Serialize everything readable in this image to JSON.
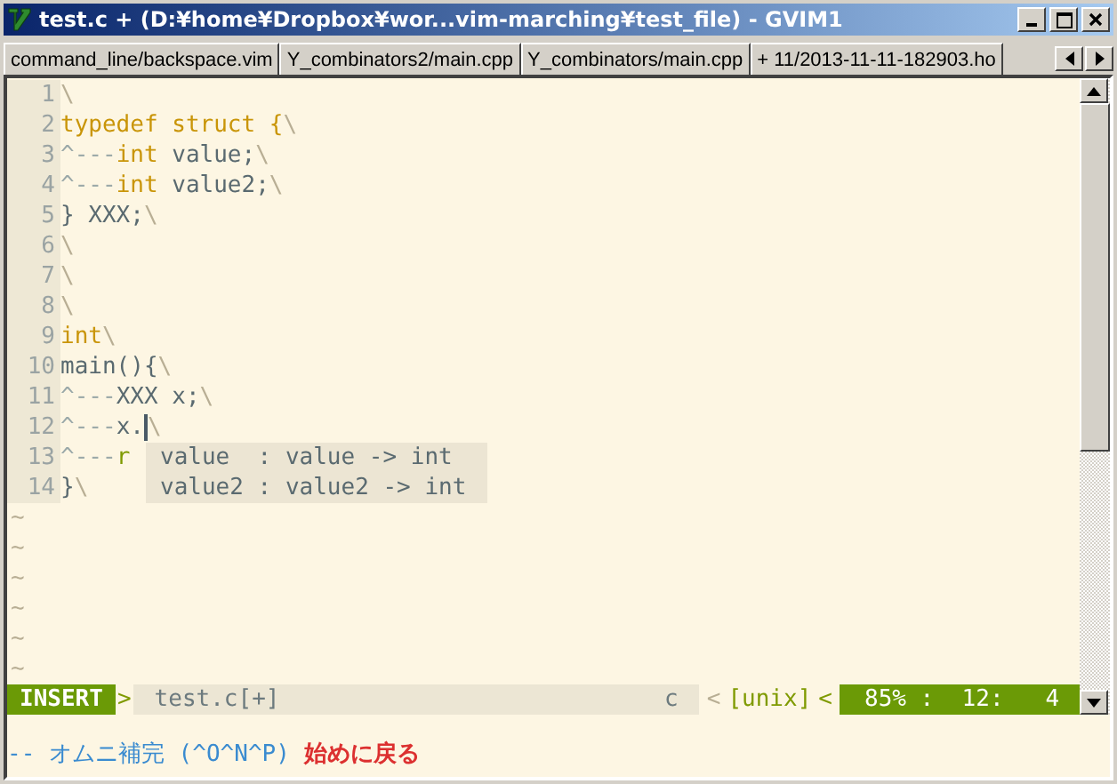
{
  "window": {
    "title": "test.c + (D:¥home¥Dropbox¥wor...vim-marching¥test_file) - GVIM1"
  },
  "tabs": [
    {
      "label": "command_line/backspace.vim"
    },
    {
      "label": "Y_combinators2/main.cpp"
    },
    {
      "label": "Y_combinators/main.cpp"
    },
    {
      "label": "+ 11/2013-11-11-182903.ho"
    }
  ],
  "lines": [
    {
      "number": "1",
      "eol": "\\",
      "cursor": false
    },
    {
      "number": "2",
      "segments": [
        {
          "text": "typedef struct {",
          "kind": "type"
        }
      ],
      "eol": "\\",
      "cursor": false
    },
    {
      "number": "3",
      "segments": [
        {
          "text": "^---",
          "kind": "tab"
        },
        {
          "text": "int",
          "kind": "type"
        },
        {
          "text": " value;",
          "kind": "normal"
        }
      ],
      "eol": "\\",
      "cursor": false
    },
    {
      "number": "4",
      "segments": [
        {
          "text": "^---",
          "kind": "tab"
        },
        {
          "text": "int",
          "kind": "type"
        },
        {
          "text": " value2;",
          "kind": "normal"
        }
      ],
      "eol": "\\",
      "cursor": false
    },
    {
      "number": "5",
      "segments": [
        {
          "text": "} XXX;",
          "kind": "normal"
        }
      ],
      "eol": "\\",
      "cursor": false
    },
    {
      "number": "6",
      "eol": "\\",
      "cursor": false
    },
    {
      "number": "7",
      "eol": "\\",
      "cursor": false
    },
    {
      "number": "8",
      "eol": "\\",
      "cursor": false
    },
    {
      "number": "9",
      "segments": [
        {
          "text": "int",
          "kind": "type"
        }
      ],
      "eol": "\\",
      "cursor": false
    },
    {
      "number": "10",
      "segments": [
        {
          "text": "main(){",
          "kind": "normal"
        }
      ],
      "eol": "\\",
      "cursor": false
    },
    {
      "number": "11",
      "segments": [
        {
          "text": "^---",
          "kind": "tab"
        },
        {
          "text": "XXX x;",
          "kind": "normal"
        }
      ],
      "eol": "\\",
      "cursor": false
    },
    {
      "number": "12",
      "segments": [
        {
          "text": "^---",
          "kind": "tab"
        },
        {
          "text": "x.",
          "kind": "normal"
        }
      ],
      "eol": "\\",
      "cursor": true
    },
    {
      "number": "13",
      "segments": [
        {
          "text": "^---",
          "kind": "tab"
        },
        {
          "text": "r",
          "kind": "green"
        }
      ],
      "cursor": false
    },
    {
      "number": "14",
      "segments": [
        {
          "text": "}",
          "kind": "normal"
        }
      ],
      "eol": "\\",
      "cursor": false
    }
  ],
  "filler_lines": [
    "~",
    "~",
    "~",
    "~",
    "~",
    "~"
  ],
  "popup": {
    "items": [
      "value  : value -> int",
      "value2 : value2 -> int"
    ]
  },
  "status_line": {
    "mode": "INSERT",
    "sep_left": ">",
    "file": "test.c[+]",
    "filetype": "c",
    "sep_ft": "<",
    "format": "[unix]",
    "sep_right": "<",
    "position": "85% :  12:   4"
  },
  "command_line": {
    "message": "-- オムニ補完 (^O^N^P)",
    "alert": "始めに戻る"
  }
}
